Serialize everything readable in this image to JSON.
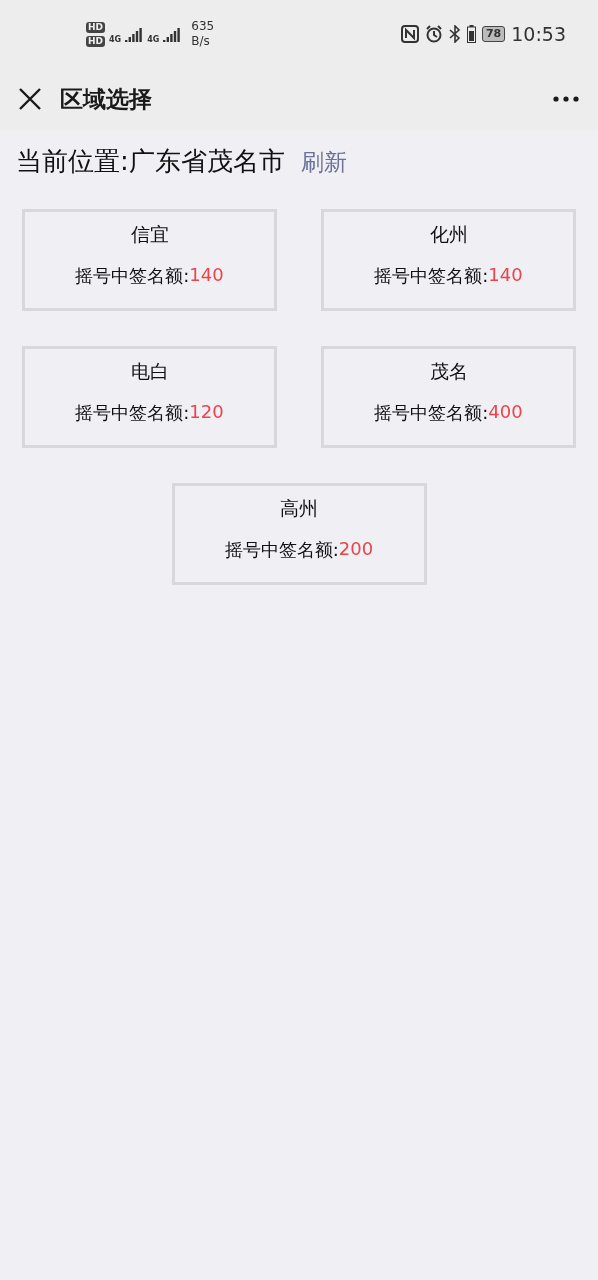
{
  "status_bar": {
    "sim_badges": [
      "HD",
      "HD"
    ],
    "network_labels": [
      "4G",
      "4G"
    ],
    "speed_value": "635",
    "speed_unit": "B/s",
    "battery": "78",
    "time": "10:53"
  },
  "header": {
    "title": "区域选择"
  },
  "location": {
    "text": "当前位置:广东省茂名市",
    "refresh": "刷新"
  },
  "regions": [
    {
      "name": "信宜",
      "label": "摇号中签名额:",
      "count": "140"
    },
    {
      "name": "化州",
      "label": "摇号中签名额:",
      "count": "140"
    },
    {
      "name": "电白",
      "label": "摇号中签名额:",
      "count": "120"
    },
    {
      "name": "茂名",
      "label": "摇号中签名额:",
      "count": "400"
    },
    {
      "name": "高州",
      "label": "摇号中签名额:",
      "count": "200"
    }
  ]
}
